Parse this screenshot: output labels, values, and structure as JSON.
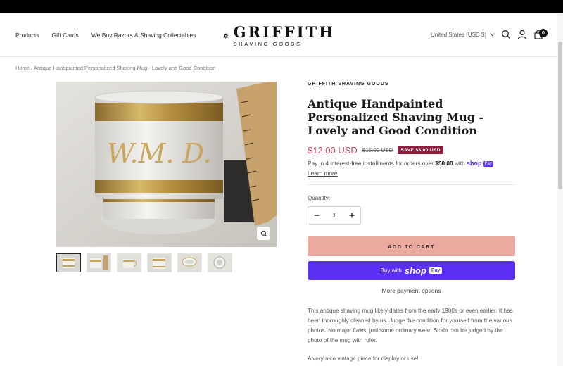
{
  "nav": {
    "items": [
      "Products",
      "Gift Cards",
      "We Buy Razors & Shaving Collectables"
    ]
  },
  "logo": {
    "main": "GRIFFITH",
    "sub": "SHAVING GOODS"
  },
  "header": {
    "currency": "United States (USD $)",
    "cart_count": "0"
  },
  "breadcrumb": {
    "home": "Home",
    "separator": "/",
    "current": "Antique Handpainted Personalized Shaving Mug - Lovely and Good Condition"
  },
  "product": {
    "vendor": "GRIFFITH SHAVING GOODS",
    "title": "Antique Handpainted Personalized Shaving Mug - Lovely and Good Condition",
    "price": "$12.00 USD",
    "compare_price": "$15.00 USD",
    "save_badge": "SAVE $3.00 USD",
    "installments_text": "Pay in 4 interest-free installments for orders over",
    "installments_amount": "$50.00",
    "installments_with": "with",
    "shop_word": "shop",
    "shop_pay_badge": "Pay",
    "learn_more": "Learn more",
    "quantity_label": "Quantity:",
    "quantity": "1",
    "add_to_cart": "ADD TO CART",
    "buy_with": "Buy with",
    "buy_shop": "shop",
    "buy_pay": "Pay",
    "more_payment": "More payment options",
    "description": "This antique shaving mug likely dates from the early 1900s or even earlier. It has been thoroughly cleaned by us. Judge the condition for yourself from the various photos. No major flaws, just some ordinary wear. Scale can be judged by the photo of the mug with ruler.",
    "description2": "A very nice vintage piece for display or use!"
  },
  "colors": {
    "price": "#c0495e",
    "save_badge": "#8f1f3c",
    "add_to_cart": "#eba9a0",
    "shop_pay": "#5a31f4"
  },
  "icons": [
    "search-icon",
    "account-icon",
    "cart-icon",
    "chevron-down-icon",
    "zoom-icon",
    "minus-icon",
    "plus-icon"
  ]
}
